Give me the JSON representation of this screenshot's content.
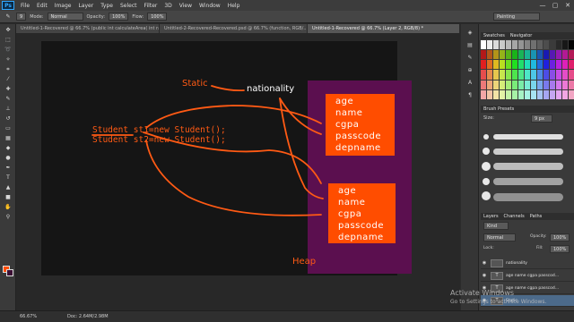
{
  "app": {
    "logo": "Ps"
  },
  "menu": [
    "File",
    "Edit",
    "Image",
    "Layer",
    "Type",
    "Select",
    "Filter",
    "3D",
    "View",
    "Window",
    "Help"
  ],
  "window_controls": [
    "—",
    "▢",
    "✕"
  ],
  "options": {
    "mode_label": "Mode:",
    "mode_value": "Normal",
    "opacity_label": "Opacity:",
    "opacity_value": "100%",
    "flow_label": "Flow:",
    "flow_value": "100%",
    "brush_size": "9",
    "workspace": "Painting"
  },
  "tabs": [
    {
      "label": "Untitled-1-Recovered @ 66.7% (public int calculateArea( int radius)) · int ar...",
      "active": false
    },
    {
      "label": "Untitled-2-Recovered-Recovered.psd @ 66.7% (function, RGB/...",
      "active": false
    },
    {
      "label": "Untitled-1-Recovered @ 66.7% (Layer 2, RGB/8) *",
      "active": true
    }
  ],
  "canvas": {
    "static_label": "Static",
    "nationality_label": "nationality",
    "code_line1": "Student st1=new Student();",
    "code_line2": "Student st2=new Student();",
    "object1_fields": [
      "age",
      "name",
      "cgpa",
      "passcode",
      "depname"
    ],
    "object2_fields": [
      "age",
      "name",
      "cgpa",
      "passcode",
      "depname"
    ],
    "heap_label": "Heap"
  },
  "panels": {
    "swatches_tabs": [
      "Swatches",
      "Navigator"
    ],
    "brush_tabs": [
      "Brush Presets"
    ],
    "brush_size_label": "Size:",
    "brush_size_value": "9 px",
    "layers_tabs": [
      "Layers",
      "Channels",
      "Paths"
    ],
    "layers_kind": "Kind",
    "blend_mode": "Normal",
    "opacity_label": "Opacity:",
    "opacity_value": "100%",
    "lock_label": "Lock:",
    "fill_label": "Fill:",
    "fill_value": "100%",
    "layers": [
      {
        "name": "nationality",
        "type": "text"
      },
      {
        "name": "age name cgpa passcod...",
        "type": "text"
      },
      {
        "name": "age name cgpa passcod...",
        "type": "text"
      },
      {
        "name": "Static",
        "type": "text"
      }
    ]
  },
  "status": {
    "zoom": "66.67%",
    "doc": "Doc: 2.64M/2.98M"
  },
  "watermark": {
    "line1": "Activate Windows",
    "line2": "Go to Settings to activate Windows."
  },
  "colors": {
    "accent_orange": "#ff4d00",
    "heap_purple": "#5b0f4f",
    "text_orange": "#ff5a14"
  }
}
